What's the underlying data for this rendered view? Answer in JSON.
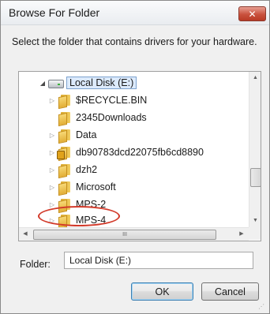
{
  "window": {
    "title": "Browse For Folder",
    "close_symbol": "✕"
  },
  "instruction": "Select the folder that contains drivers for your hardware.",
  "tree": {
    "items": [
      {
        "label": "Local Disk (E:)",
        "icon": "disk-icon",
        "expander": "expanded",
        "selected": true
      },
      {
        "label": "$RECYCLE.BIN",
        "icon": "folder-icon",
        "expander": "collapsed"
      },
      {
        "label": "2345Downloads",
        "icon": "folder-icon",
        "expander": "none"
      },
      {
        "label": "Data",
        "icon": "folder-icon",
        "expander": "collapsed"
      },
      {
        "label": "db90783dcd22075fb6cd8890",
        "icon": "locked-folder-icon",
        "expander": "collapsed"
      },
      {
        "label": "dzh2",
        "icon": "folder-icon",
        "expander": "collapsed"
      },
      {
        "label": "Microsoft",
        "icon": "folder-icon",
        "expander": "collapsed"
      },
      {
        "label": "MPS-2",
        "icon": "folder-icon",
        "expander": "collapsed"
      },
      {
        "label": "MPS-4",
        "icon": "folder-icon",
        "expander": "collapsed",
        "annotated": true
      }
    ],
    "hscroll_thumb_glyph": "III"
  },
  "folder": {
    "label": "Folder:",
    "value": "Local Disk (E:)"
  },
  "buttons": {
    "ok": "OK",
    "cancel": "Cancel"
  },
  "colors": {
    "annotation": "#d23a2a",
    "selection": "#dceafc",
    "close_button": "#c9513d"
  }
}
